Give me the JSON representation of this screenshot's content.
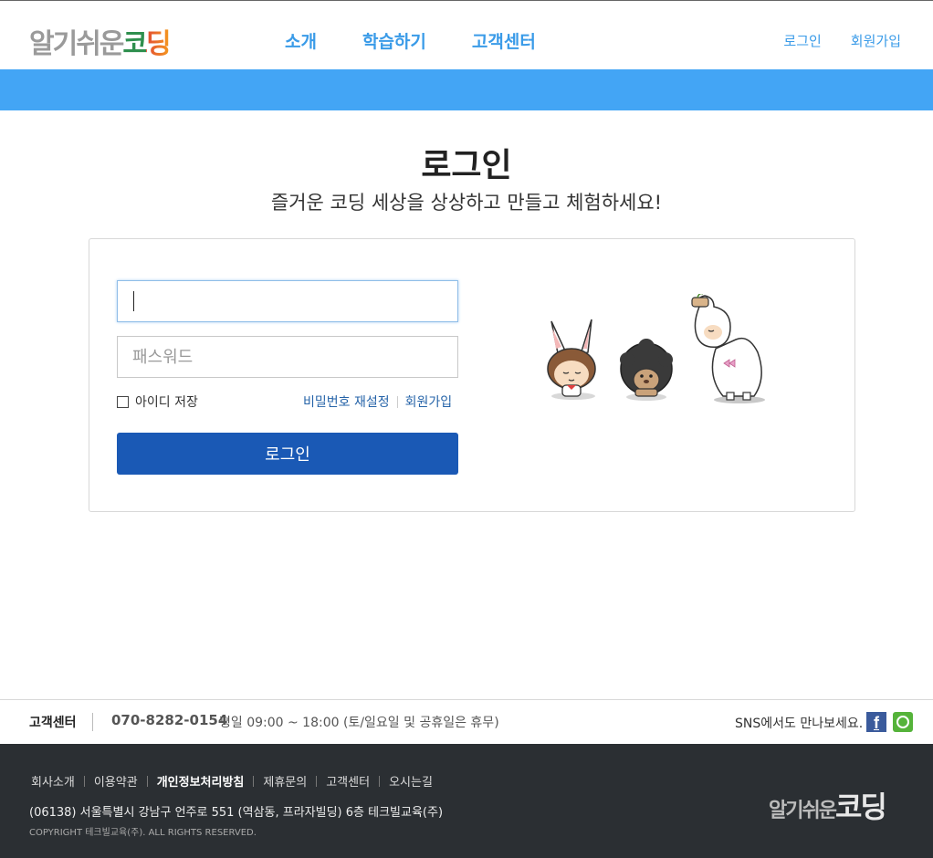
{
  "header": {
    "logo_text": "알기쉬운",
    "logo_text_accent": "코딩",
    "nav": [
      "소개",
      "학습하기",
      "고객센터"
    ],
    "login_link": "로그인",
    "signup_link": "회원가입"
  },
  "main": {
    "title": "로그인",
    "subtitle": "즐거운 코딩 세상을 상상하고 만들고 체험하세요!",
    "id_value": "",
    "password_placeholder": "패스워드",
    "remember_label": "아이디 저장",
    "reset_password_link": "비밀번호 재설정",
    "signup_link": "회원가입",
    "login_button": "로그인"
  },
  "info_bar": {
    "label": "고객센터",
    "phone": "070-8282-0154",
    "hours": "평일 09:00 ~ 18:00 (토/일요일 및 공휴일은 휴무)",
    "sns_label": "SNS에서도 만나보세요."
  },
  "footer": {
    "links": [
      "회사소개",
      "이용약관",
      "개인정보처리방침",
      "제휴문의",
      "고객센터",
      "오시는길"
    ],
    "address": "(06138) 서울특별시 강남구 언주로 551 (역삼동, 프라자빌딩) 6층 테크빌교육(주)",
    "copyright": "COPYRIGHT 테크빌교육(주). ALL RIGHTS RESERVED.",
    "logo_text": "알기쉬운",
    "logo_text_accent": "코딩"
  },
  "colors": {
    "accent": "#43a5f5",
    "nav_text": "#3a9be8",
    "login_button": "#1a59b5",
    "footer_bg": "#2b2f33"
  }
}
